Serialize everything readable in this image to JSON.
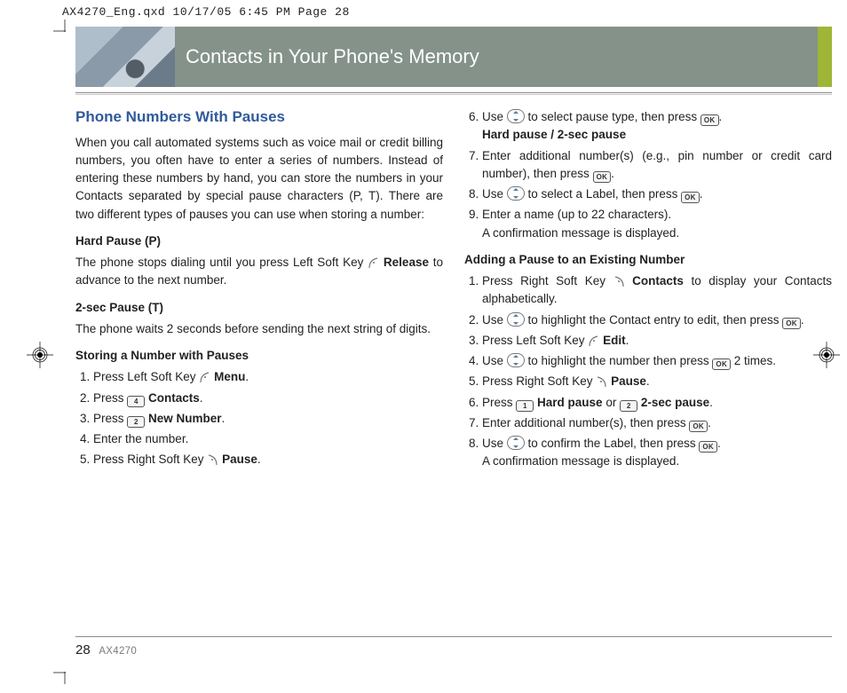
{
  "slug": "AX4270_Eng.qxd  10/17/05  6:45 PM  Page 28",
  "banner": {
    "title": "Contacts in Your Phone's Memory"
  },
  "left": {
    "section_title": "Phone Numbers With Pauses",
    "intro": "When you call automated systems such as voice mail or credit billing numbers, you often have to enter a series of numbers. Instead of entering these numbers by hand, you can store the numbers in your Contacts separated by special pause characters (P, T). There are two different types of pauses you can use when storing a number:",
    "hard_pause_head": "Hard Pause (P)",
    "hard_pause_text_a": "The phone stops dialing until you press Left Soft Key ",
    "hard_pause_release": "Release",
    "hard_pause_text_b": " to advance to the next number.",
    "two_sec_head": "2-sec Pause (T)",
    "two_sec_text": "The phone waits 2 seconds before sending the next string of digits.",
    "store_head": "Storing a Number with Pauses",
    "s1a": "Press Left Soft Key ",
    "s1b": "Menu",
    "s1c": ".",
    "s2a": "Press ",
    "s2b": "Contacts",
    "s2c": ".",
    "s3a": "Press ",
    "s3b": "New Number",
    "s3c": ".",
    "s4": "Enter the number.",
    "s5a": "Press Right Soft Key ",
    "s5b": "Pause",
    "s5c": "."
  },
  "right": {
    "s6a": "Use ",
    "s6b": " to select pause type, then press ",
    "s6c": ".",
    "s6d": "Hard pause / 2-sec pause",
    "s7a": "Enter additional number(s) (e.g., pin number or credit card number), then press ",
    "s7b": ".",
    "s8a": "Use ",
    "s8b": " to select a Label, then press ",
    "s8c": ".",
    "s9a": "Enter a name (up to 22 characters).",
    "s9b": "A confirmation message is displayed.",
    "add_head": "Adding a Pause to an Existing Number",
    "a1a": "Press Right Soft Key ",
    "a1b": "Contacts",
    "a1c": " to display your Contacts alphabetically.",
    "a2a": "Use ",
    "a2b": " to highlight the Contact entry to edit, then press ",
    "a2c": ".",
    "a3a": "Press Left Soft Key ",
    "a3b": "Edit",
    "a3c": ".",
    "a4a": "Use ",
    "a4b": " to highlight the number then press ",
    "a4c": " 2 times.",
    "a5a": "Press Right Soft Key ",
    "a5b": "Pause",
    "a5c": ".",
    "a6a": "Press ",
    "a6b": "Hard pause",
    "a6c": " or ",
    "a6d": "2-sec pause",
    "a6e": ".",
    "a7a": "Enter additional number(s), then press ",
    "a7b": ".",
    "a8a": "Use ",
    "a8b": " to confirm the Label, then press ",
    "a8c": ".",
    "a8d": "A confirmation message is displayed."
  },
  "keys": {
    "ok": "OK",
    "k1": "1",
    "k2": "2",
    "k4": "4"
  },
  "footer": {
    "page": "28",
    "model": "AX4270"
  }
}
